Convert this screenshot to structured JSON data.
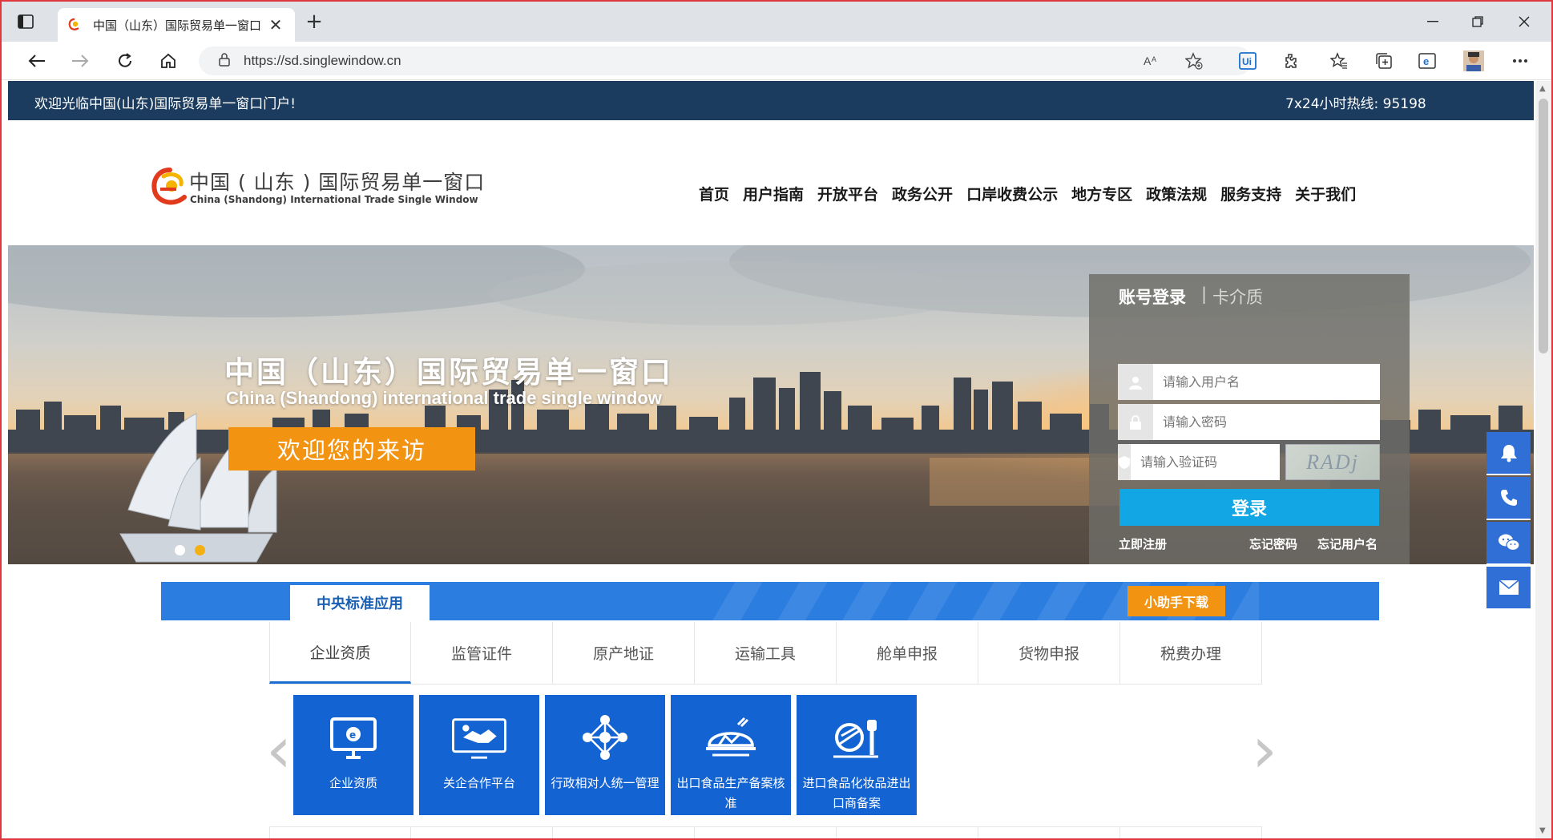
{
  "browser": {
    "tab_title": "中国（山东）国际贸易单一窗口",
    "url": "https://sd.singlewindow.cn",
    "new_tab": "+",
    "close": "✕"
  },
  "page": {
    "welcome": "欢迎光临中国(山东)国际贸易单一窗口门户!",
    "hotline": "7x24小时热线: 95198"
  },
  "header": {
    "logo_cn": "中国 ( 山东 ) 国际贸易单一窗口",
    "logo_en": "China (Shandong) International Trade Single Window",
    "nav": [
      "首页",
      "用户指南",
      "开放平台",
      "政务公开",
      "口岸收费公示",
      "地方专区",
      "政策法规",
      "服务支持",
      "关于我们"
    ]
  },
  "banner": {
    "title": "中国（山东）国际贸易单一窗口",
    "subtitle": "China (Shandong) international trade single window",
    "button": "欢迎您的来访"
  },
  "login": {
    "tab_account": "账号登录",
    "separator": "|",
    "tab_card": "卡介质",
    "username_placeholder": "请输入用户名",
    "password_placeholder": "请输入密码",
    "captcha_placeholder": "请输入验证码",
    "captcha_text": "RADj",
    "submit": "登录",
    "register": "立即注册",
    "forgot_password": "忘记密码",
    "forgot_username": "忘记用户名"
  },
  "apps": {
    "active_tab": "中央标准应用",
    "helper_download": "小助手下载",
    "subtabs": [
      "企业资质",
      "监管证件",
      "原产地证",
      "运输工具",
      "舱单申报",
      "货物申报",
      "税费办理"
    ],
    "cards": [
      {
        "label": "企业资质"
      },
      {
        "label": "关企合作平台"
      },
      {
        "label": "行政相对人统一管理"
      },
      {
        "label": "出口食品生产备案核准"
      },
      {
        "label": "进口食品化妆品进出口商备案"
      }
    ],
    "prev": "‹",
    "next": "›"
  },
  "colors": {
    "topbar": "#1b3c5f",
    "accent_blue": "#2b7ee0",
    "card_blue": "#1364d2",
    "orange": "#f39312",
    "login_button": "#12a6e5"
  }
}
